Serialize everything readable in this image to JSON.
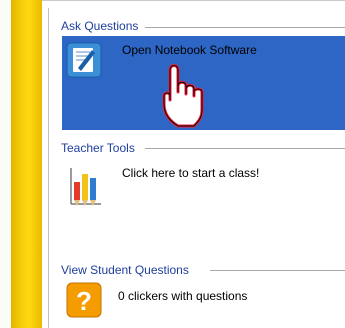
{
  "sections": {
    "ask": {
      "title": "Ask Questions",
      "item": {
        "label": "Open Notebook Software",
        "icon": "notebook-icon"
      }
    },
    "teacher": {
      "title": "Teacher Tools",
      "item": {
        "label": "Click here to start a class!",
        "icon": "pencils-chart-icon"
      }
    },
    "student": {
      "title": "View Student Questions",
      "item": {
        "label": "0 clickers with questions",
        "icon": "question-mark-icon"
      }
    }
  },
  "cursor": "hand-pointer-icon",
  "colors": {
    "accent_bar": "#f8ce0a",
    "selection": "#2d66c4",
    "heading": "#1e3f9c"
  }
}
